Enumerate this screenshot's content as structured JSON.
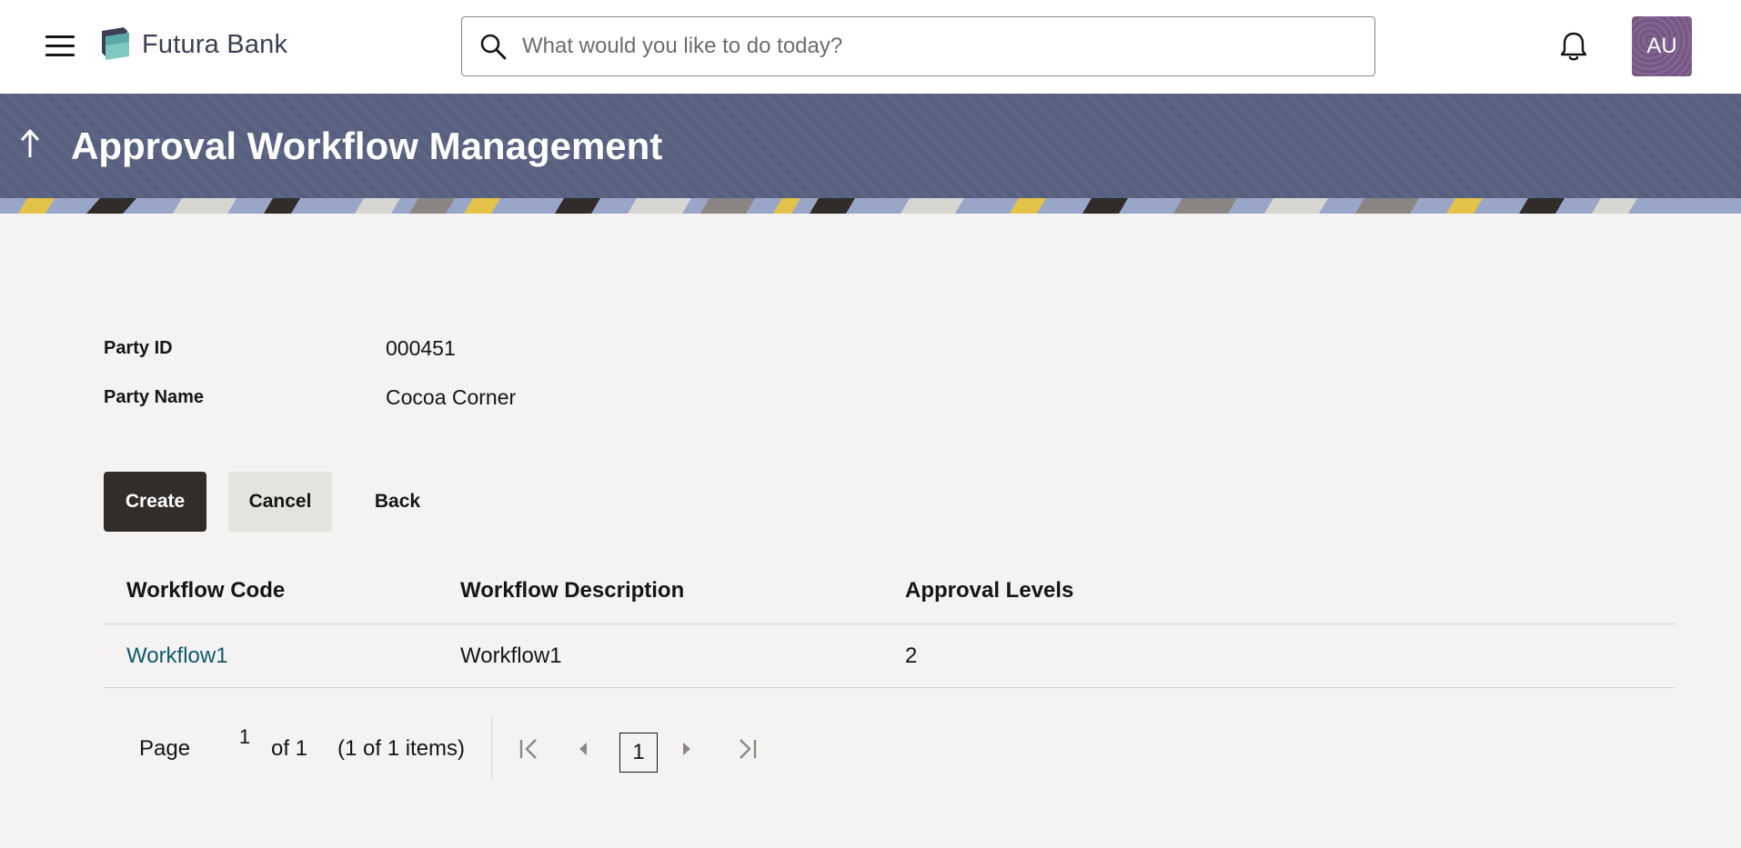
{
  "header": {
    "brand": "Futura Bank",
    "search_placeholder": "What would you like to do today?",
    "avatar_initials": "AU",
    "avatar_color": "#7a5b8a"
  },
  "banner": {
    "title": "Approval Workflow Management",
    "color": "#596181"
  },
  "details": {
    "party_id_label": "Party ID",
    "party_id_value": "000451",
    "party_name_label": "Party Name",
    "party_name_value": "Cocoa Corner"
  },
  "actions": {
    "create": "Create",
    "cancel": "Cancel",
    "back": "Back"
  },
  "table": {
    "headers": [
      "Workflow Code",
      "Workflow Description",
      "Approval Levels"
    ],
    "rows": [
      {
        "code": "Workflow1",
        "description": "Workflow1",
        "levels": "2"
      }
    ]
  },
  "pagination": {
    "page_label": "Page",
    "current_page": "1",
    "of_label": "of 1",
    "items_summary": "(1 of 1 items)",
    "selected_page": "1"
  },
  "colors": {
    "primary_button": "#312d2a",
    "link": "#0e5a6e",
    "background": "#f4f3f1"
  }
}
